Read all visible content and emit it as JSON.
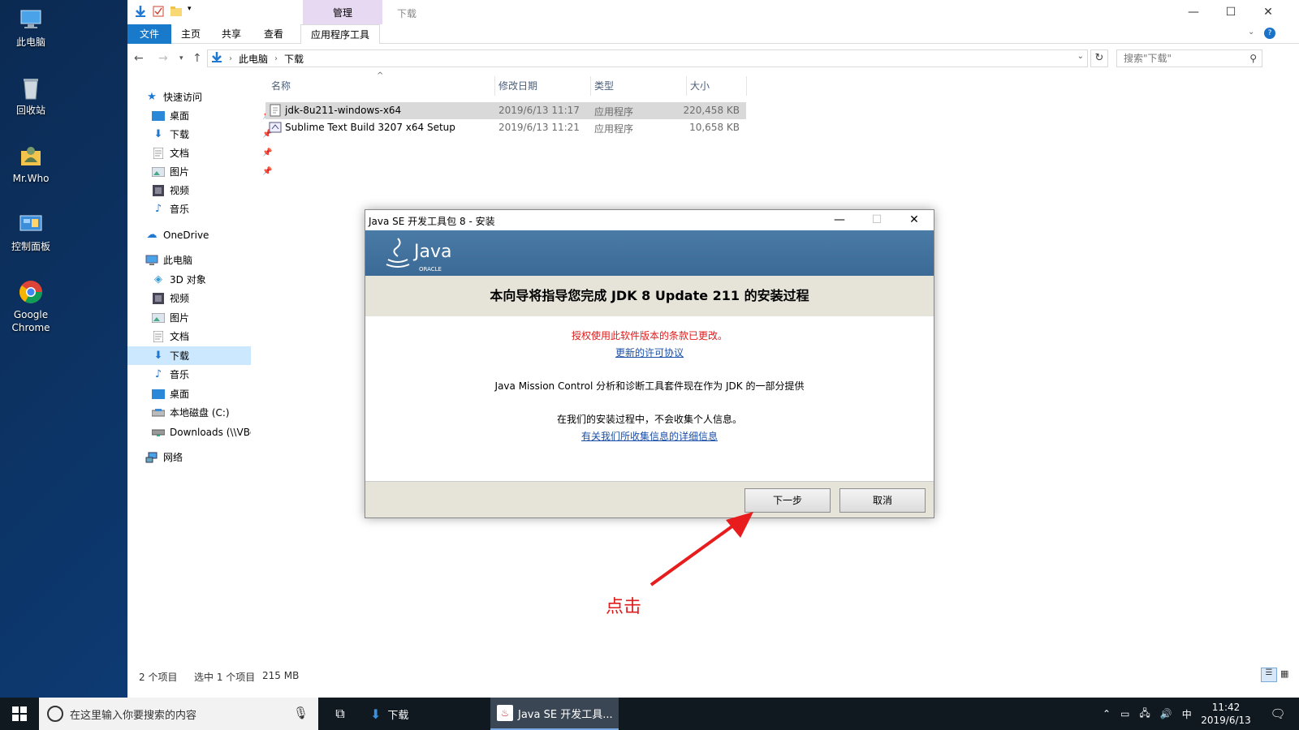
{
  "desktop": {
    "icons": [
      {
        "label": "此电脑"
      },
      {
        "label": "回收站"
      },
      {
        "label": "Mr.Who"
      },
      {
        "label": "控制面板"
      },
      {
        "label": "Google Chrome"
      }
    ]
  },
  "explorer": {
    "manage_tab": "管理",
    "window_title": "下载",
    "ribbon": {
      "file": "文件",
      "home": "主页",
      "share": "共享",
      "view": "查看",
      "app_tools": "应用程序工具"
    },
    "address": {
      "root": "此电脑",
      "folder": "下载"
    },
    "search_placeholder": "搜索\"下载\"",
    "nav": {
      "quick_access": "快速访问",
      "quick_items": [
        "桌面",
        "下载",
        "文档",
        "图片",
        "视频",
        "音乐"
      ],
      "onedrive": "OneDrive",
      "this_pc": "此电脑",
      "pc_items": [
        "3D 对象",
        "视频",
        "图片",
        "文档",
        "下载",
        "音乐",
        "桌面",
        "本地磁盘 (C:)",
        "Downloads (\\\\VBo"
      ],
      "network": "网络"
    },
    "columns": {
      "name": "名称",
      "date": "修改日期",
      "type": "类型",
      "size": "大小"
    },
    "files": [
      {
        "name": "jdk-8u211-windows-x64",
        "date": "2019/6/13 11:17",
        "type": "应用程序",
        "size": "220,458 KB"
      },
      {
        "name": "Sublime Text Build 3207 x64 Setup",
        "date": "2019/6/13 11:21",
        "type": "应用程序",
        "size": "10,658 KB"
      }
    ],
    "status": {
      "count": "2 个项目",
      "selected": "选中 1 个项目",
      "size": "215 MB"
    }
  },
  "dialog": {
    "title": "Java SE 开发工具包 8 - 安装",
    "java_logo_text": "Java",
    "oracle_text": "ORACLE",
    "heading": "本向导将指导您完成 JDK 8 Update 211 的安装过程",
    "license_changed": "授权使用此软件版本的条款已更改。",
    "license_link": "更新的许可协议",
    "jmc_note": "Java Mission Control 分析和诊断工具套件现在作为 JDK 的一部分提供",
    "privacy_note": "在我们的安装过程中，不会收集个人信息。",
    "privacy_link": "有关我们所收集信息的详细信息",
    "next_button": "下一步",
    "cancel_button": "取消"
  },
  "annotation": "点击",
  "taskbar": {
    "search_placeholder": "在这里输入你要搜索的内容",
    "downloads_label": "下载",
    "java_label": "Java SE 开发工具...",
    "ime": "中",
    "time": "11:42",
    "date": "2019/6/13"
  }
}
